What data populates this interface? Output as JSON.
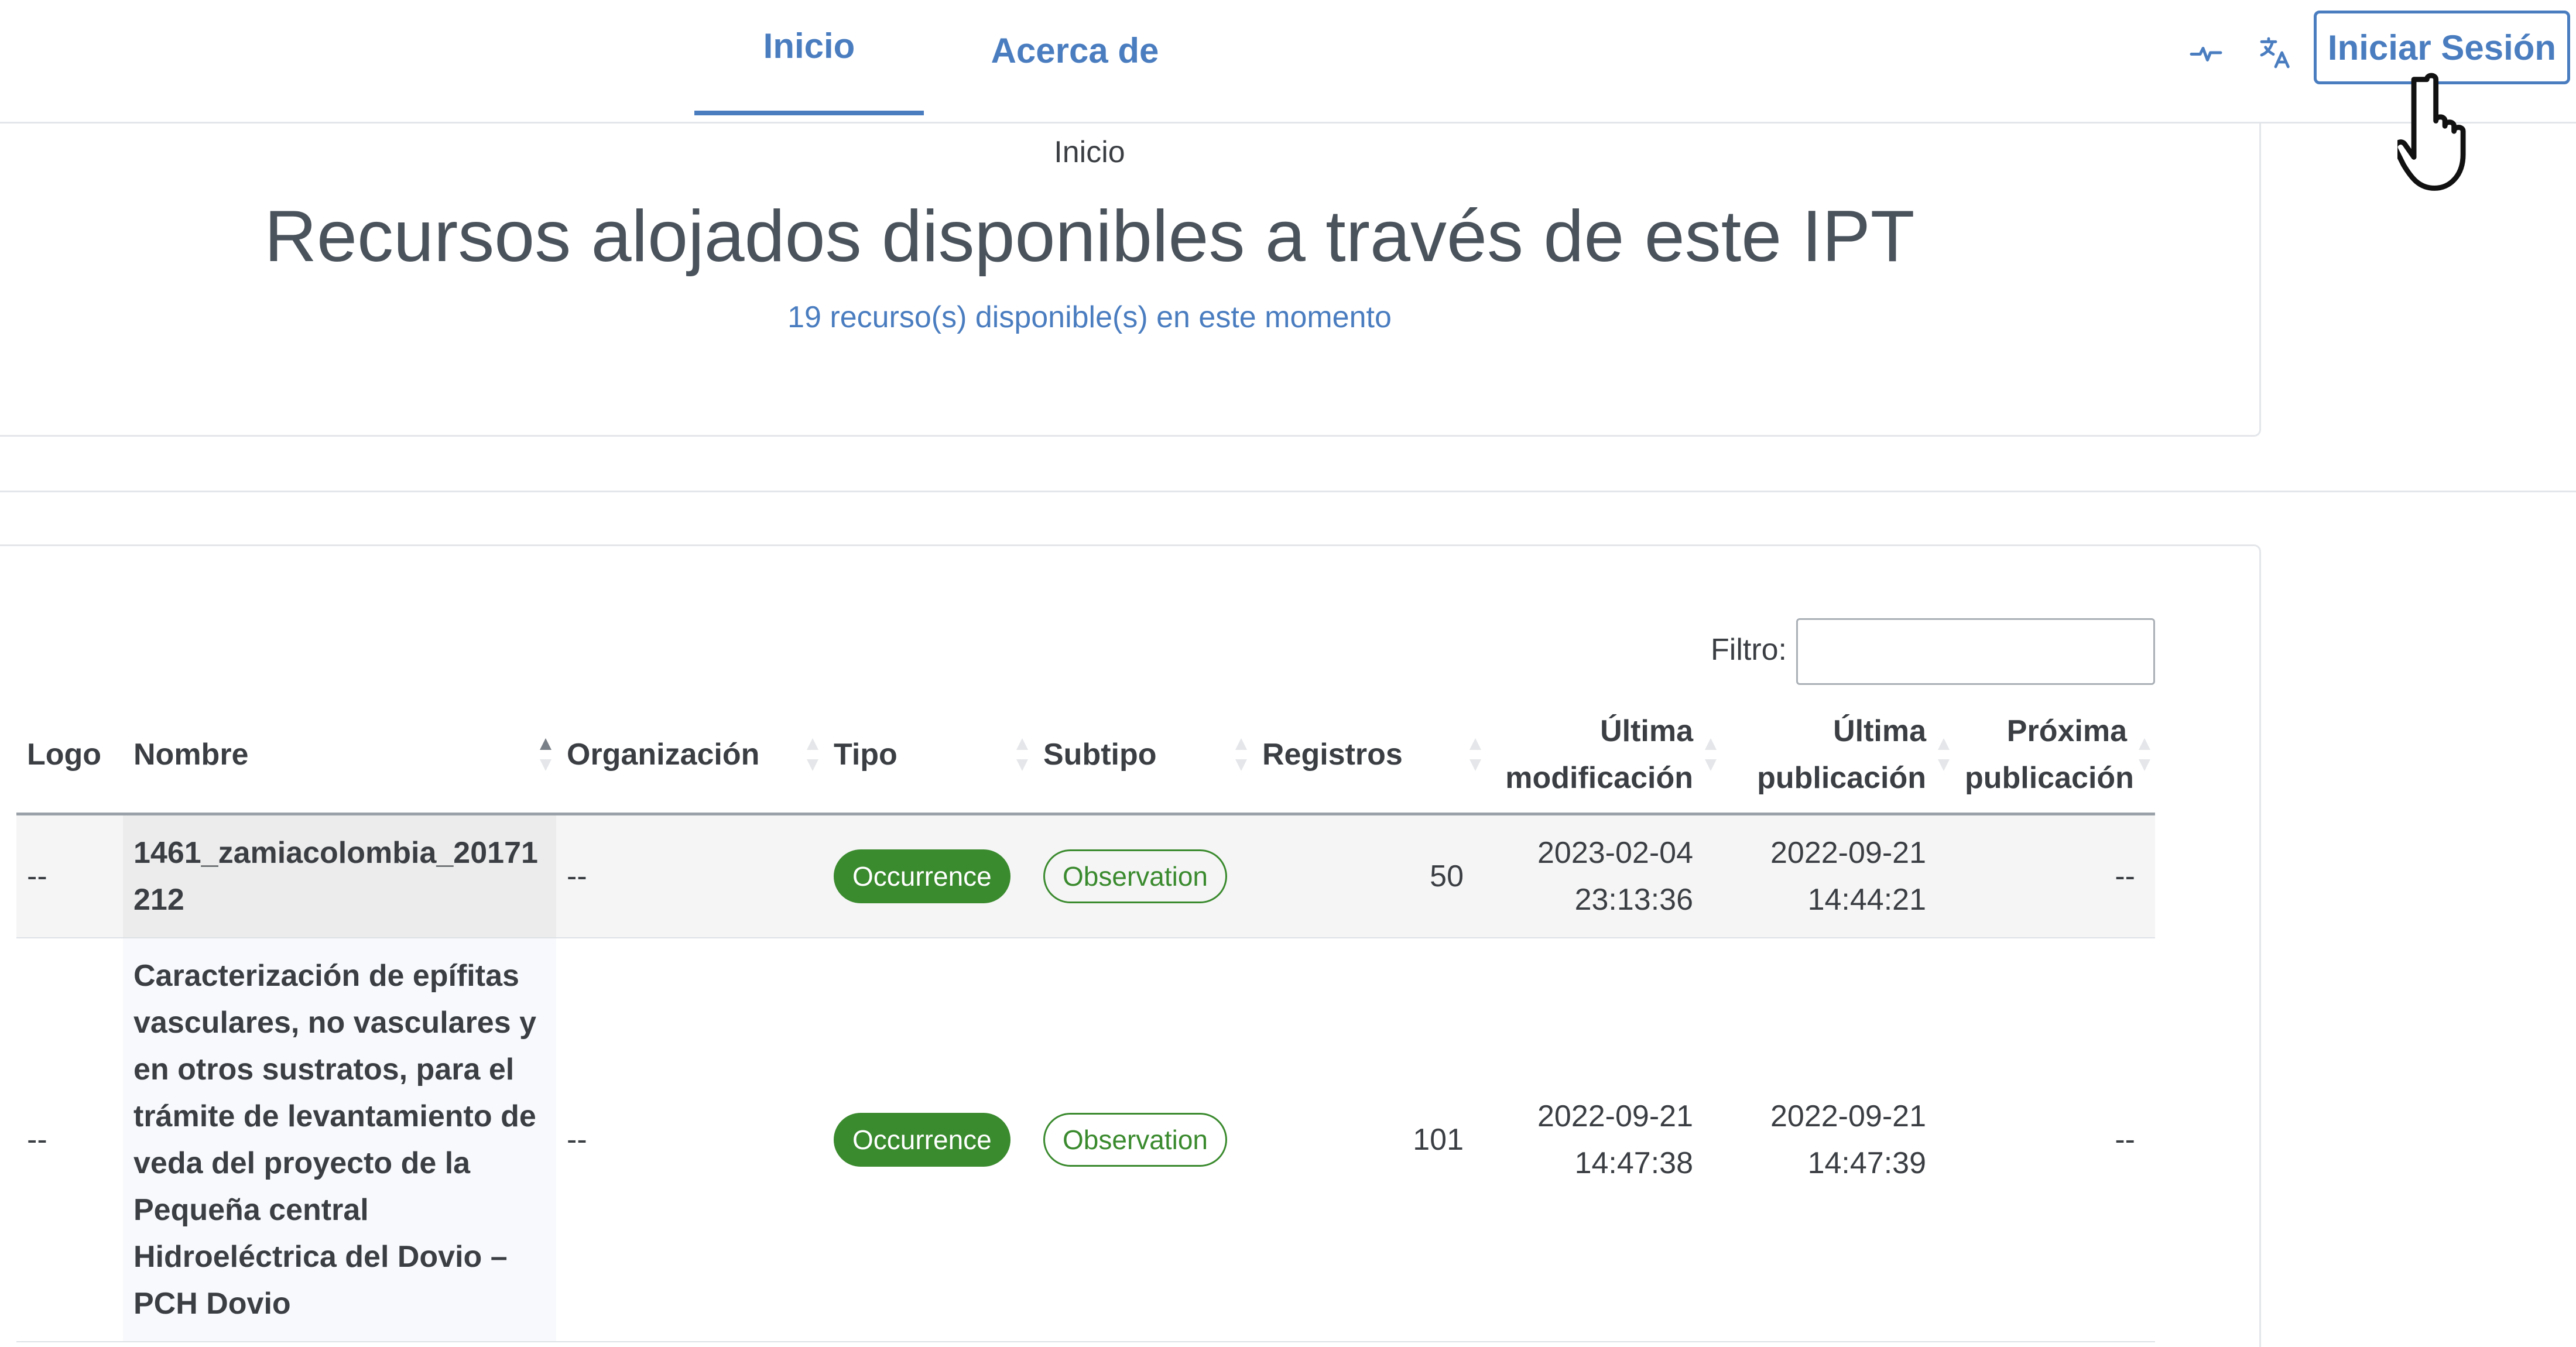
{
  "nav": {
    "tabs": [
      {
        "label": "Inicio",
        "active": true
      },
      {
        "label": "Acerca de",
        "active": false
      }
    ],
    "icons": [
      "activity-icon",
      "translate-icon"
    ],
    "login_label": "Iniciar Sesión",
    "accent_color": "#4a7dc0"
  },
  "header": {
    "breadcrumb": "Inicio",
    "title": "Recursos alojados disponibles a través de este IPT",
    "subtitle": "19 recurso(s) disponible(s) en este momento"
  },
  "filter": {
    "label": "Filtro:",
    "value": ""
  },
  "table": {
    "columns": [
      {
        "label": "Logo"
      },
      {
        "label": "Nombre"
      },
      {
        "label": "Organización"
      },
      {
        "label": "Tipo"
      },
      {
        "label": "Subtipo"
      },
      {
        "label": "Registros"
      },
      {
        "label": "Última modificación"
      },
      {
        "label": "Última publicación"
      },
      {
        "label": "Próxima publicación"
      }
    ],
    "sorted_column": "Nombre",
    "sort_direction": "ascending",
    "rows": [
      {
        "logo": "--",
        "nombre": "1461_zamiacolombia_20171212",
        "organizacion": "--",
        "tipo": "Occurrence",
        "subtipo": "Observation",
        "registros": "50",
        "ultima_modificacion": "2023-02-04 23:13:36",
        "ultima_publicacion": "2022-09-21 14:44:21",
        "proxima_publicacion": "--"
      },
      {
        "logo": "--",
        "nombre": "Caracterización de epífitas vasculares, no vasculares y en otros sustratos, para el trámite de levantamiento de veda del proyecto de la Pequeña central Hidroeléctrica del Dovio – PCH Dovio",
        "organizacion": "--",
        "tipo": "Occurrence",
        "subtipo": "Observation",
        "registros": "101",
        "ultima_modificacion": "2022-09-21 14:47:38",
        "ultima_publicacion": "2022-09-21 14:47:39",
        "proxima_publicacion": "--"
      }
    ],
    "badge_color": "#3a8a2e"
  }
}
